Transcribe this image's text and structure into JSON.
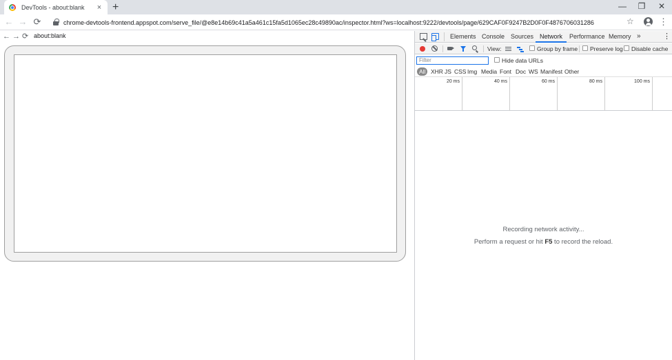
{
  "browser": {
    "tab": {
      "title": "DevTools - about:blank",
      "close": "×"
    },
    "new_tab": "+",
    "window_controls": {
      "minimize": "—",
      "restore": "❐",
      "close": "✕"
    },
    "toolbar": {
      "back": "←",
      "forward": "→",
      "reload": "⟳",
      "url": "chrome-devtools-frontend.appspot.com/serve_file/@e8e14b69c41a5a461c15fa5d1065ec28c49890ac/inspector.html?ws=localhost:9222/devtools/page/629CAF0F9247B2D0F0F4876706031286",
      "star": "☆",
      "menu": "⋮"
    }
  },
  "page": {
    "back": "←",
    "forward": "→",
    "reload": "⟳",
    "address": "about:blank"
  },
  "devtools": {
    "tabs": [
      "Elements",
      "Console",
      "Sources",
      "Network",
      "Performance",
      "Memory"
    ],
    "active_tab": "Network",
    "more": "»",
    "menu": "⋮",
    "network": {
      "view_label": "View:",
      "group_by_frame": "Group by frame",
      "preserve_log": "Preserve log",
      "disable_cache": "Disable cache",
      "filter_placeholder": "Filter",
      "hide_data_urls": "Hide data URLs",
      "types": [
        "All",
        "XHR",
        "JS",
        "CSS",
        "Img",
        "Media",
        "Font",
        "Doc",
        "WS",
        "Manifest",
        "Other"
      ],
      "timeline_ticks": [
        "20 ms",
        "40 ms",
        "60 ms",
        "80 ms",
        "100 ms"
      ],
      "empty_line1": "Recording network activity...",
      "empty_line2_pre": "Perform a request or hit ",
      "empty_line2_key": "F5",
      "empty_line2_post": " to record the reload."
    }
  },
  "colors": {
    "accent": "#1a73e8",
    "record": "#e53935"
  }
}
